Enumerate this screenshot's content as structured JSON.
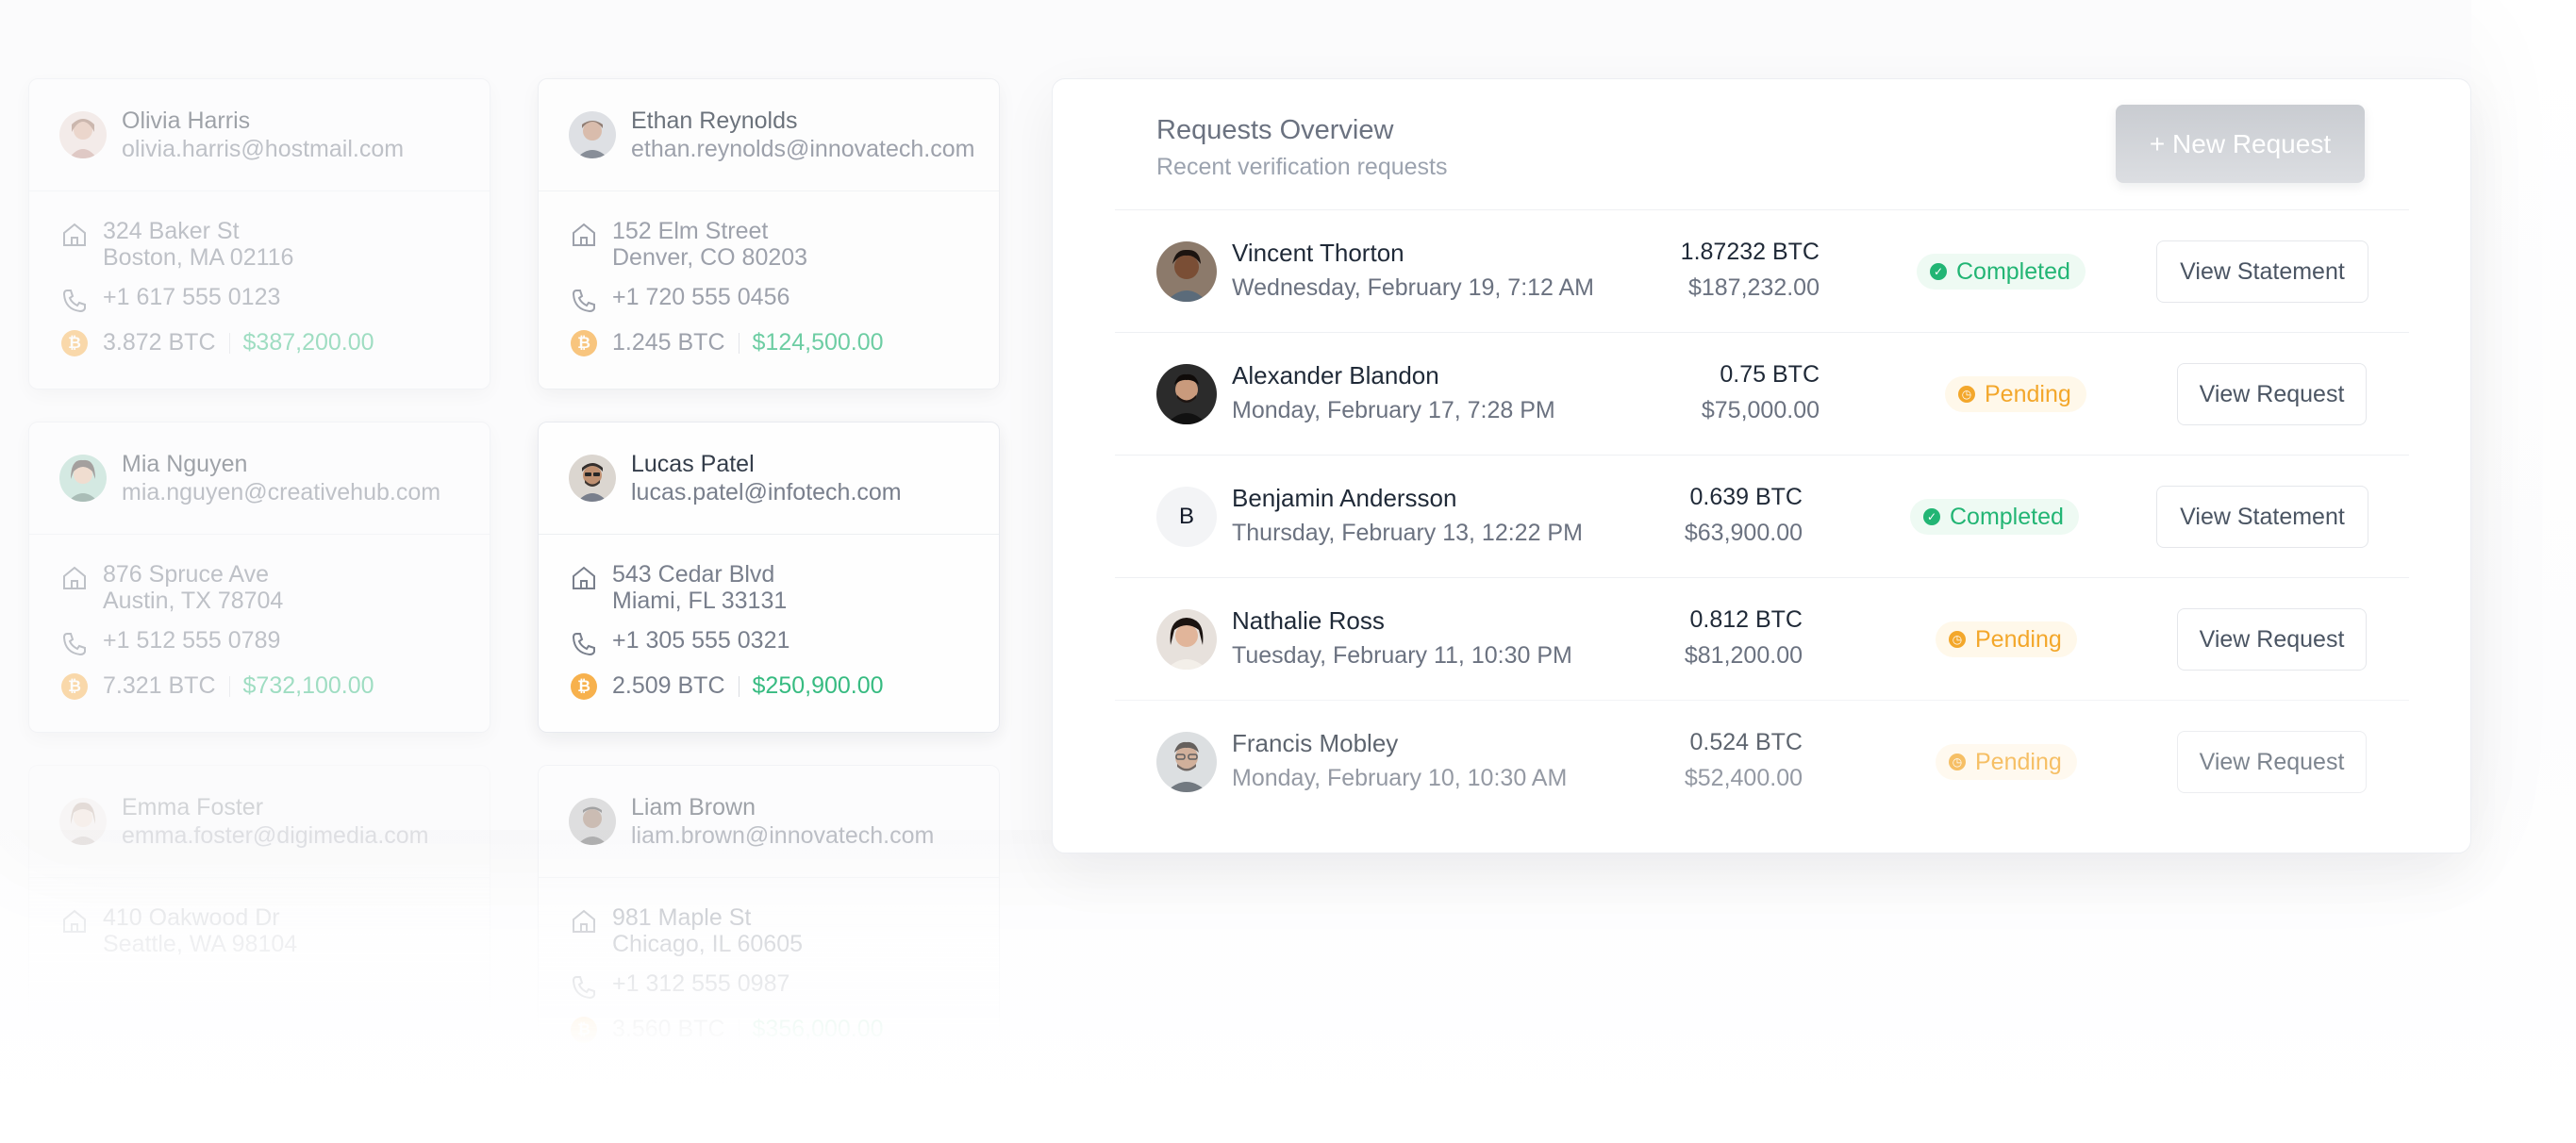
{
  "contacts": [
    {
      "name": "Olivia Harris",
      "email": "olivia.harris@hostmail.com",
      "address_1": "324 Baker St",
      "address_2": "Boston, MA 02116",
      "phone": "+1 617 555 0123",
      "btc": "3.872 BTC",
      "usd": "$387,200.00"
    },
    {
      "name": "Ethan Reynolds",
      "email": "ethan.reynolds@innovatech.com",
      "address_1": "152 Elm Street",
      "address_2": "Denver, CO 80203",
      "phone": "+1 720 555 0456",
      "btc": "1.245 BTC",
      "usd": "$124,500.00"
    },
    {
      "name": "Mia Nguyen",
      "email": "mia.nguyen@creativehub.com",
      "address_1": "876 Spruce Ave",
      "address_2": "Austin, TX 78704",
      "phone": "+1 512 555 0789",
      "btc": "7.321 BTC",
      "usd": "$732,100.00"
    },
    {
      "name": "Lucas Patel",
      "email": "lucas.patel@infotech.com",
      "address_1": "543 Cedar Blvd",
      "address_2": "Miami, FL 33131",
      "phone": "+1 305 555 0321",
      "btc": "2.509 BTC",
      "usd": "$250,900.00"
    },
    {
      "name": "Emma Foster",
      "email": "emma.foster@digimedia.com",
      "address_1": "410 Oakwood Dr",
      "address_2": "Seattle, WA 98104"
    },
    {
      "name": "Liam Brown",
      "email": "liam.brown@innovatech.com",
      "address_1": "981 Maple St",
      "address_2": "Chicago, IL 60605",
      "phone": "+1 312 555 0987",
      "btc": "3.560 BTC",
      "usd": "$356,000.00"
    }
  ],
  "panel": {
    "title": "Requests Overview",
    "subtitle": "Recent verification requests",
    "new_button": "+ New Request"
  },
  "requests": [
    {
      "name": "Vincent Thorton",
      "date": "Wednesday, February 19, 7:12 AM",
      "btc": "1.87232 BTC",
      "usd": "$187,232.00",
      "status": "Completed",
      "action": "View Statement"
    },
    {
      "name": "Alexander Blandon",
      "date": "Monday, February 17, 7:28 PM",
      "btc": "0.75 BTC",
      "usd": "$75,000.00",
      "status": "Pending",
      "action": "View Request"
    },
    {
      "name": "Benjamin Andersson",
      "initial": "B",
      "date": "Thursday, February 13, 12:22 PM",
      "btc": "0.639 BTC",
      "usd": "$63,900.00",
      "status": "Completed",
      "action": "View Statement"
    },
    {
      "name": "Nathalie Ross",
      "date": "Tuesday, February 11, 10:30 PM",
      "btc": "0.812 BTC",
      "usd": "$81,200.00",
      "status": "Pending",
      "action": "View Request"
    },
    {
      "name": "Francis Mobley",
      "date": "Monday, February 10, 10:30 AM",
      "btc": "0.524 BTC",
      "usd": "$52,400.00",
      "status": "Pending",
      "action": "View Request"
    }
  ],
  "icons": {
    "address": "home-icon",
    "phone": "phone-icon",
    "coin": "bitcoin-icon",
    "completed": "check-circle-icon",
    "pending": "clock-icon"
  },
  "colors": {
    "green": "#22b574",
    "orange": "#f3a72b",
    "bitcoin": "#f7a93b"
  }
}
